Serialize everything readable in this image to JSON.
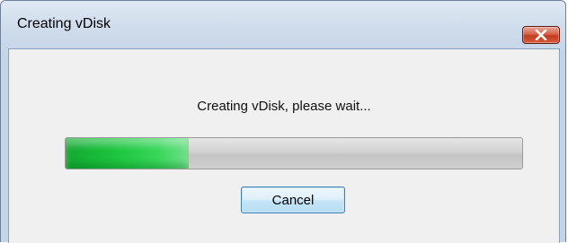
{
  "window": {
    "title": "Creating vDisk",
    "close_icon": "close-icon"
  },
  "dialog": {
    "message": "Creating vDisk, please wait...",
    "progress_fraction": 0.27,
    "progress_color": "#1cc43f",
    "cancel_label": "Cancel"
  }
}
